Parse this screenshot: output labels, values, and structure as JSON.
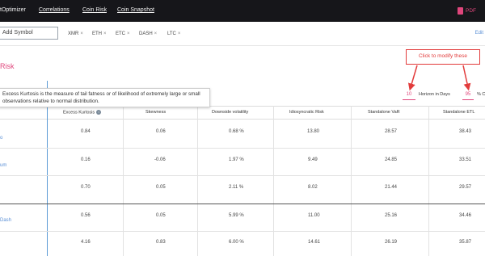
{
  "nav": {
    "items": [
      "tOptimizer",
      "Correlations",
      "Coin Risk",
      "Coin Snapshot"
    ],
    "pdf_label": "PDF"
  },
  "symbols": {
    "placeholder": "Add Symbol",
    "chips": [
      "XMR",
      "ETH",
      "ETC",
      "DASH",
      "LTC"
    ],
    "edit_label": "Edit"
  },
  "section_title": "Risk",
  "callout": "Click to modify these",
  "tooltip": "Excess Kurtosis is the measure of tail fatness or of likelihood of extremely large or small observations relative to normal distribution.",
  "horizon": {
    "days_value": "10",
    "days_label": "Horizon in Days",
    "pct_value": "95",
    "pct_label": "% C"
  },
  "table": {
    "headers": [
      "Excess Kurtosis",
      "Skewness",
      "Downside volatility",
      "Idiosyncratic Risk",
      "Standalone VaR",
      "Standalone ETL"
    ],
    "rows": [
      {
        "label": "o",
        "values": [
          "0.84",
          "0.06",
          "0.68 %",
          "13.80",
          "28.57",
          "38.43"
        ]
      },
      {
        "label": "um",
        "values": [
          "0.16",
          "-0.06",
          "1.97 %",
          "9.49",
          "24.85",
          "33.51"
        ]
      },
      {
        "label": "",
        "values": [
          "0.70",
          "0.05",
          "2.11 %",
          "8.02",
          "21.44",
          "29.57"
        ]
      },
      {
        "label": "Dash",
        "values": [
          "0.56",
          "0.05",
          "5.99 %",
          "11.00",
          "25.16",
          "34.46"
        ]
      },
      {
        "label": "",
        "values": [
          "4.16",
          "0.83",
          "6.00 %",
          "14.61",
          "26.19",
          "35.87"
        ]
      }
    ]
  },
  "colors": {
    "accent": "#e0467c",
    "callout": "#e23b3b",
    "link": "#5a8fd6",
    "topbar": "#16161a"
  }
}
